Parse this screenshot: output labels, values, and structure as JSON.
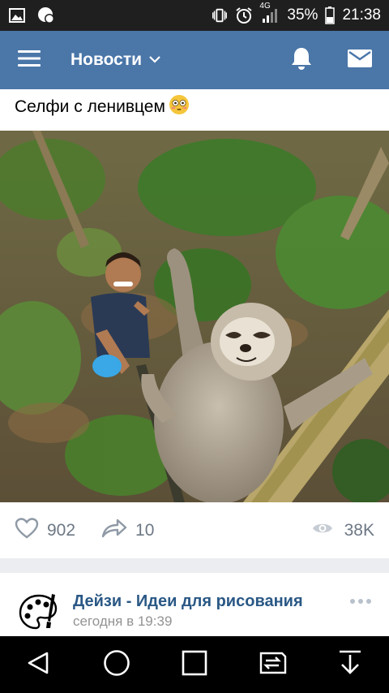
{
  "status_bar": {
    "battery": "35%",
    "time": "21:38",
    "network": "4G"
  },
  "header": {
    "title": "Новости",
    "background": "#4a76a8"
  },
  "post": {
    "text": "Селфи с ленивцем",
    "emoji": "😳",
    "likes": "902",
    "shares": "10",
    "views": "38K"
  },
  "next_post": {
    "group_name": "Дейзи - Идеи для рисования",
    "time": "сегодня в 19:39"
  },
  "icons": {
    "status_left": [
      "gallery-icon",
      "notification-badge-icon"
    ],
    "status_right": [
      "vibrate-icon",
      "alarm-icon",
      "signal-icon",
      "battery-icon"
    ],
    "header": [
      "menu-icon",
      "chevron-down-icon",
      "bell-icon",
      "mail-icon"
    ],
    "actions": [
      "heart-icon",
      "share-icon",
      "eye-icon"
    ],
    "nav": [
      "back-icon",
      "home-icon",
      "recents-icon",
      "switch-icon",
      "download-icon"
    ]
  }
}
